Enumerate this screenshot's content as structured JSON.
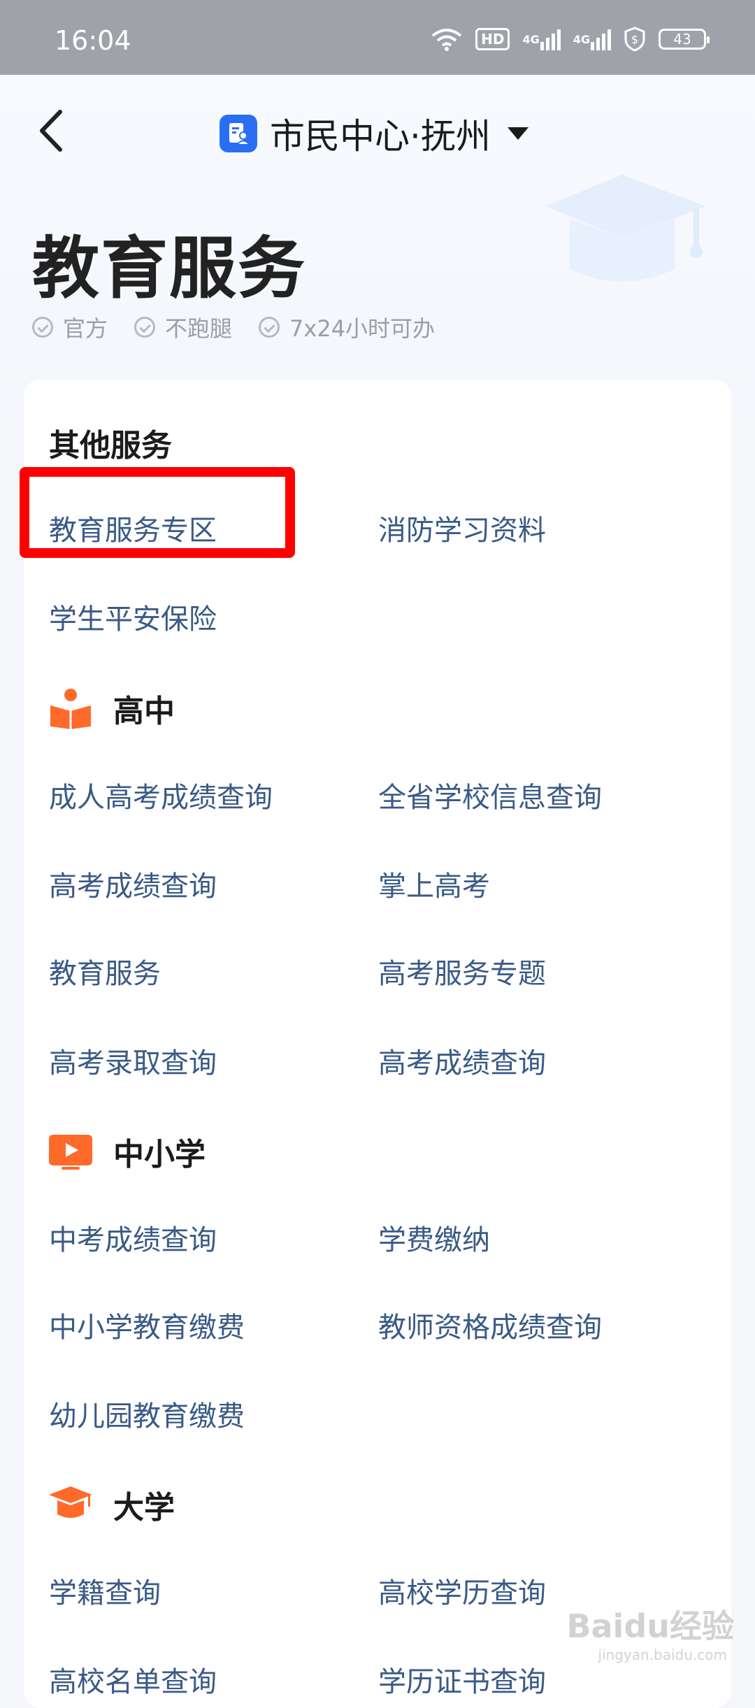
{
  "status_bar": {
    "time": "16:04",
    "hd_label": "HD",
    "net1": "4G",
    "net2": "4G",
    "battery": "43"
  },
  "header": {
    "city_label": "市民中心·抚州",
    "title": "教育服务",
    "tags": [
      "官方",
      "不跑腿",
      "7x24小时可办"
    ]
  },
  "sections": {
    "other": {
      "heading": "其他服务",
      "items": [
        "教育服务专区",
        "消防学习资料",
        "学生平安保险"
      ]
    },
    "high_school": {
      "heading": "高中",
      "items": [
        "成人高考成绩查询",
        "全省学校信息查询",
        "高考成绩查询",
        "掌上高考",
        "教育服务",
        "高考服务专题",
        "高考录取查询",
        "高考成绩查询"
      ]
    },
    "primary_middle": {
      "heading": "中小学",
      "items": [
        "中考成绩查询",
        "学费缴纳",
        "中小学教育缴费",
        "教师资格成绩查询",
        "幼儿园教育缴费"
      ]
    },
    "university": {
      "heading": "大学",
      "items": [
        "学籍查询",
        "高校学历查询",
        "高校名单查询",
        "学历证书查询"
      ]
    }
  },
  "watermark": {
    "main": "Baidu经验",
    "sub": "jingyan.baidu.com"
  },
  "colors": {
    "accent_blue": "#2a6ff3",
    "link_text": "#3a5a86",
    "section_icon_orange": "#ff6a2a",
    "highlight_red": "#ff0000"
  }
}
